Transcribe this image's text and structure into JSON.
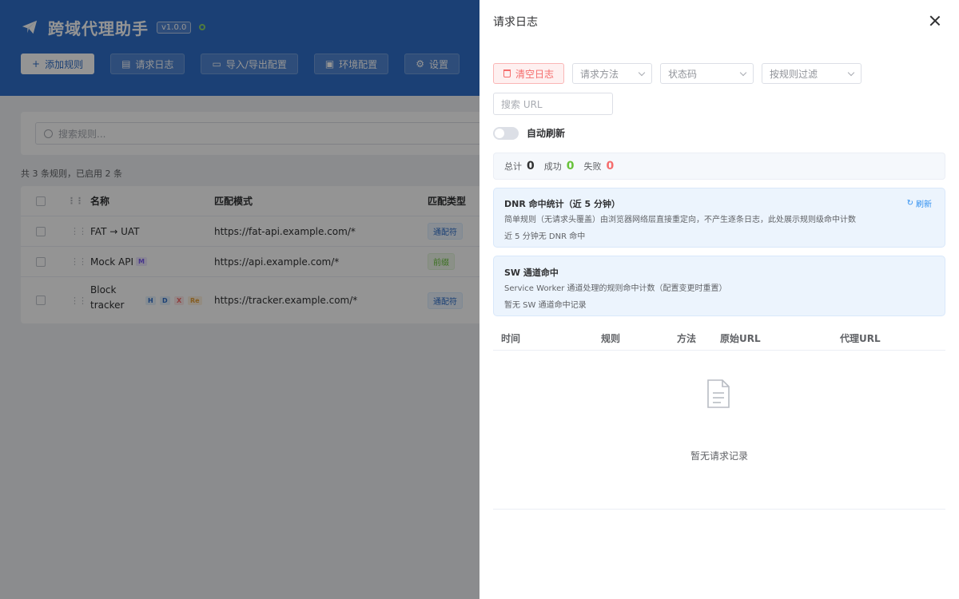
{
  "app": {
    "title": "跨域代理助手",
    "version": "v1.0.0",
    "toolbar": {
      "add_rule": "添加规则",
      "request_log": "请求日志",
      "import_export": "导入/导出配置",
      "environment": "环境配置",
      "settings": "设置"
    },
    "search_placeholder": "搜索规则...",
    "rules_summary": "共 3 条规则，已启用 2 条",
    "table": {
      "columns": [
        "名称",
        "匹配模式",
        "匹配类型"
      ],
      "rows": [
        {
          "name": "FAT → UAT",
          "pattern": "https://fat-api.example.com/*",
          "type": "通配符",
          "badges": []
        },
        {
          "name": "Mock API",
          "pattern": "https://api.example.com/*",
          "type": "前缀",
          "badges": [
            "M"
          ]
        },
        {
          "name_line1": "Block",
          "name_line2": "tracker",
          "pattern": "https://tracker.example.com/*",
          "type": "通配符",
          "badges": [
            "H",
            "D",
            "X",
            "Re"
          ]
        }
      ]
    }
  },
  "drawer": {
    "title": "请求日志",
    "clear_button": "清空日志",
    "filters": {
      "method_placeholder": "请求方法",
      "status_placeholder": "状态码",
      "rule_placeholder": "按规则过滤",
      "url_placeholder": "搜索 URL"
    },
    "auto_refresh_label": "自动刷新",
    "auto_refresh_on": false,
    "stats": {
      "total_label": "总计",
      "total": "0",
      "success_label": "成功",
      "success": "0",
      "fail_label": "失败",
      "fail": "0"
    },
    "dnr_card": {
      "title": "DNR 命中统计（近 5 分钟）",
      "refresh": "刷新",
      "description": "简单规则（无请求头覆盖）由浏览器网络层直接重定向，不产生逐条日志，此处展示规则级命中计数",
      "empty": "近 5 分钟无 DNR 命中"
    },
    "sw_card": {
      "title": "SW 通道命中",
      "description": "Service Worker 通道处理的规则命中计数（配置变更时重置）",
      "empty": "暂无 SW 通道命中记录"
    },
    "log_table": {
      "col_time": "时间",
      "col_rule": "规则",
      "col_method": "方法",
      "col_original_url": "原始URL",
      "col_proxy_url": "代理URL",
      "empty": "暂无请求记录"
    }
  },
  "colors": {
    "header_blue": "#2f6fca",
    "success": "#67c23a",
    "danger": "#f56c6c",
    "link": "#2f8ff0"
  },
  "icons": [
    "paper-plane-icon",
    "plus-icon",
    "document-icon",
    "folder-icon",
    "save-icon",
    "gear-icon",
    "search-icon",
    "drag-handle-icon",
    "trash-icon",
    "chevron-down-icon",
    "close-icon",
    "refresh-icon",
    "empty-document-icon"
  ]
}
